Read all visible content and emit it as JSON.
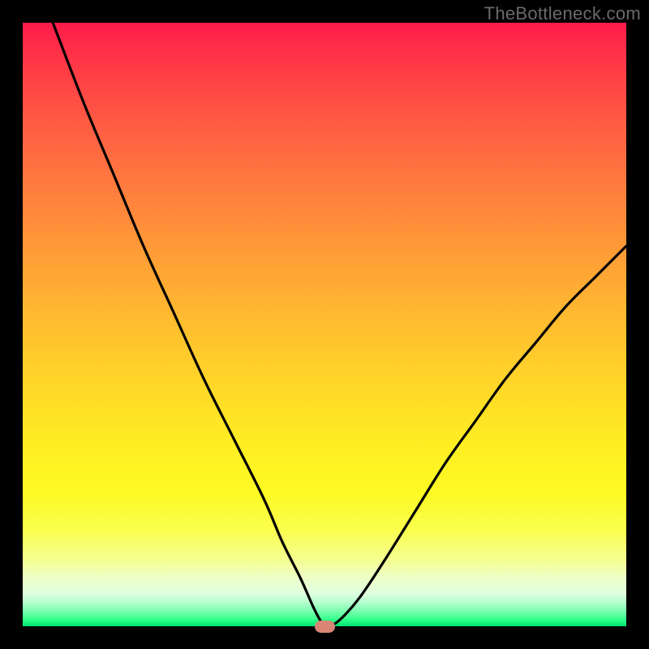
{
  "watermark": "TheBottleneck.com",
  "chart_data": {
    "type": "line",
    "title": "",
    "xlabel": "",
    "ylabel": "",
    "xlim": [
      0,
      100
    ],
    "ylim": [
      0,
      100
    ],
    "x": [
      5,
      10,
      15,
      20,
      25,
      30,
      35,
      40,
      43,
      46,
      48,
      49,
      50,
      51,
      53,
      56,
      60,
      65,
      70,
      75,
      80,
      85,
      90,
      95,
      100
    ],
    "values": [
      100,
      87,
      75,
      63,
      52,
      41,
      31,
      21,
      14,
      8,
      3.5,
      1.5,
      0,
      0,
      1.5,
      5,
      11,
      19,
      27,
      34,
      41,
      47,
      53,
      58,
      63
    ],
    "marker": {
      "x": 50,
      "y": 0
    }
  },
  "colors": {
    "curve": "#000000",
    "marker": "#d98576",
    "frame": "#000000"
  }
}
